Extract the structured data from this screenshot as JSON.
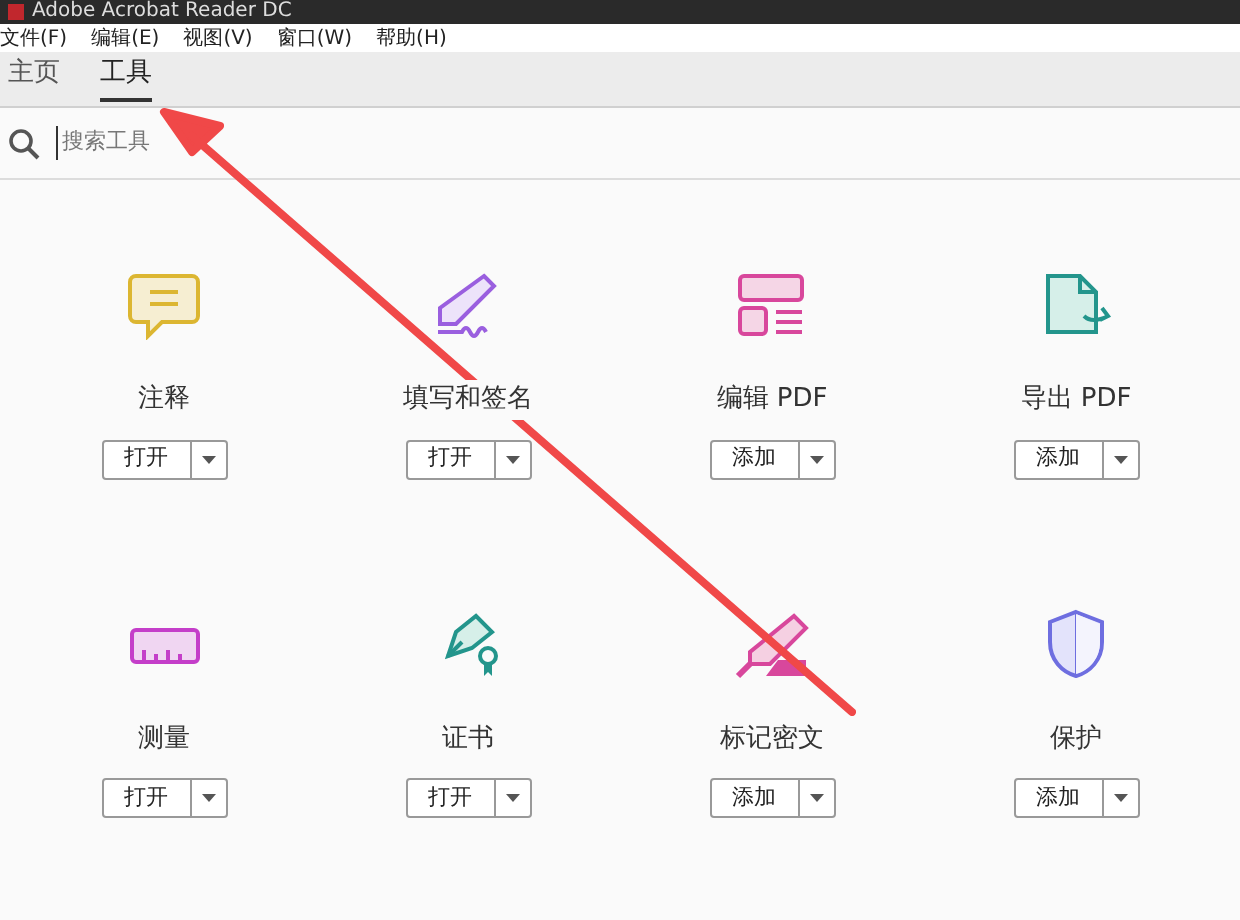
{
  "window": {
    "title": "Adobe Acrobat Reader DC"
  },
  "menu": [
    "文件(F)",
    "编辑(E)",
    "视图(V)",
    "窗口(W)",
    "帮助(H)"
  ],
  "tabs": [
    {
      "label": "主页",
      "selected": false
    },
    {
      "label": "工具",
      "selected": true
    }
  ],
  "search": {
    "placeholder": "搜索工具"
  },
  "tools": [
    {
      "kind": "comment",
      "name": "注释",
      "button": "打开"
    },
    {
      "kind": "sign",
      "name": "填写和签名",
      "button": "打开"
    },
    {
      "kind": "edit",
      "name": "编辑 PDF",
      "button": "添加"
    },
    {
      "kind": "export",
      "name": "导出 PDF",
      "button": "添加"
    },
    {
      "kind": "measure",
      "name": "测量",
      "button": "打开"
    },
    {
      "kind": "certificate",
      "name": "证书",
      "button": "打开"
    },
    {
      "kind": "redact",
      "name": "标记密文",
      "button": "添加"
    },
    {
      "kind": "protect",
      "name": "保护",
      "button": "添加"
    }
  ]
}
